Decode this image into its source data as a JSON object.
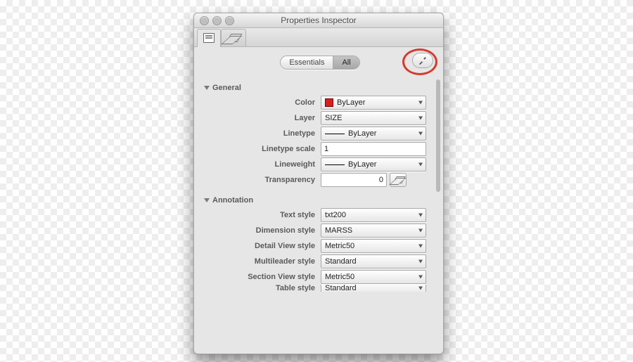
{
  "window": {
    "title": "Properties Inspector"
  },
  "mode": {
    "essentials": "Essentials",
    "all": "All",
    "active": "all"
  },
  "groups": {
    "general": {
      "title": "General",
      "rows": {
        "color": {
          "label": "Color",
          "value": "ByLayer"
        },
        "layer": {
          "label": "Layer",
          "value": "SIZE"
        },
        "linetype": {
          "label": "Linetype",
          "value": "ByLayer"
        },
        "ltscale": {
          "label": "Linetype scale",
          "value": "1"
        },
        "lineweight": {
          "label": "Lineweight",
          "value": "ByLayer"
        },
        "transparency": {
          "label": "Transparency",
          "value": "0"
        }
      }
    },
    "annotation": {
      "title": "Annotation",
      "rows": {
        "textstyle": {
          "label": "Text style",
          "value": "txt200"
        },
        "dimstyle": {
          "label": "Dimension style",
          "value": "MARSS"
        },
        "detailview": {
          "label": "Detail View style",
          "value": "Metric50"
        },
        "mleader": {
          "label": "Multileader style",
          "value": "Standard"
        },
        "sectionview": {
          "label": "Section View style",
          "value": "Metric50"
        },
        "tablestyle": {
          "label": "Table style",
          "value": "Standard"
        }
      }
    }
  }
}
